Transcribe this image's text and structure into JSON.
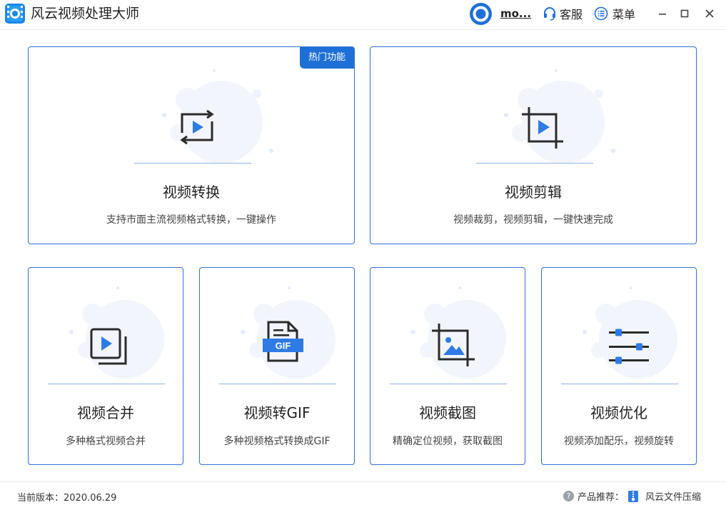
{
  "app": {
    "title": "风云视频处理大师",
    "user_name": "mo...",
    "service_label": "客服",
    "menu_label": "菜单"
  },
  "cards": [
    {
      "title": "视频转换",
      "desc": "支持市面主流视频格式转换，一键操作",
      "badge": "热门功能",
      "icon": "convert-icon"
    },
    {
      "title": "视频剪辑",
      "desc": "视频裁剪，视频剪辑，一键快速完成",
      "icon": "crop-play-icon"
    },
    {
      "title": "视频合并",
      "desc": "多种格式视频合并",
      "icon": "merge-icon"
    },
    {
      "title": "视频转GIF",
      "desc": "多种视频格式转换成GIF",
      "icon": "gif-file-icon",
      "icon_text": "GIF"
    },
    {
      "title": "视频截图",
      "desc": "精确定位视频，获取截图",
      "icon": "screenshot-crop-icon"
    },
    {
      "title": "视频优化",
      "desc": "视频添加配乐，视频旋转",
      "icon": "sliders-icon"
    }
  ],
  "footer": {
    "version_label": "当前版本：2020.06.29",
    "recommend_label": "产品推荐：",
    "recommend_product": "风云文件压缩"
  },
  "colors": {
    "accent": "#1f6fd9",
    "border": "#2f6fd6",
    "icon_dark": "#2b2b2b",
    "icon_blue": "#2f7be6"
  }
}
